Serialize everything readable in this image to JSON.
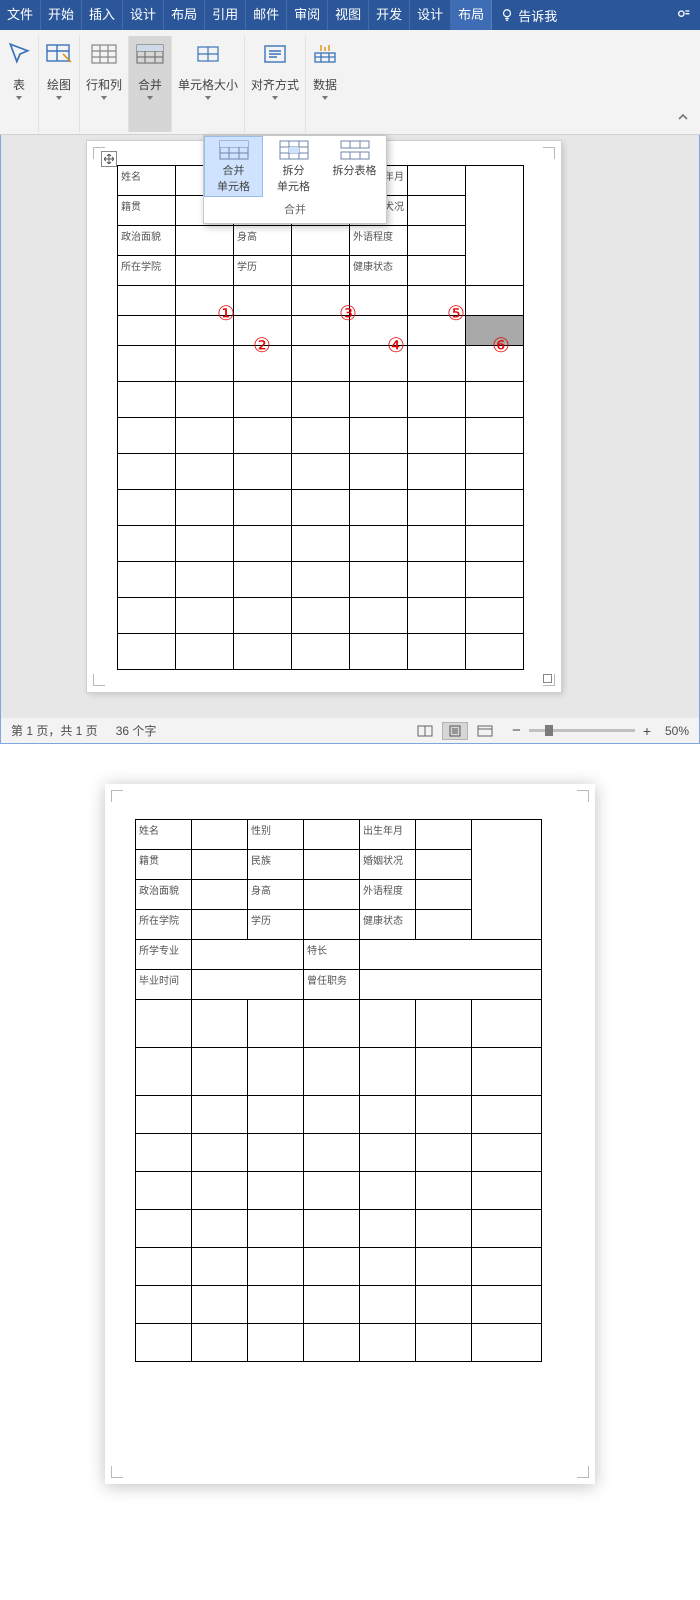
{
  "tabs": {
    "file": "文件",
    "home": "开始",
    "insert": "插入",
    "design": "设计",
    "layout1": "布局",
    "ref": "引用",
    "mail": "邮件",
    "review": "审阅",
    "view": "视图",
    "dev": "开发",
    "design2": "设计",
    "layout2": "布局",
    "tell": "告诉我"
  },
  "ribbon": {
    "table": "表",
    "draw": "绘图",
    "rowcol": "行和列",
    "merge": "合并",
    "cellsize": "单元格大小",
    "align": "对齐方式",
    "data": "数据"
  },
  "popup": {
    "mergeCells": "合并\n单元格",
    "splitCells": "拆分\n单元格",
    "splitTable": "拆分表格",
    "groupTitle": "合并"
  },
  "form": {
    "name": "姓名",
    "gender": "性别",
    "birth": "出生年月",
    "hidden_birth": "年月",
    "native": "籍贯",
    "nation": "民族",
    "marital": "婚姻状况",
    "hidden_marital": "犬况",
    "politics": "政治面貌",
    "height": "身高",
    "foreign": "外语程度",
    "college": "所在学院",
    "edu": "学历",
    "health": "健康状态",
    "major": "所学专业",
    "specialty": "特长",
    "gradtime": "毕业时间",
    "duty": "曾任职务"
  },
  "annot": {
    "a1": "①",
    "a2": "②",
    "a3": "③",
    "a4": "④",
    "a5": "⑤",
    "a6": "⑥"
  },
  "status": {
    "page": "第 1 页，共 1 页",
    "words": "36 个字",
    "zoom": "50%",
    "minus": "−",
    "plus": "+"
  }
}
